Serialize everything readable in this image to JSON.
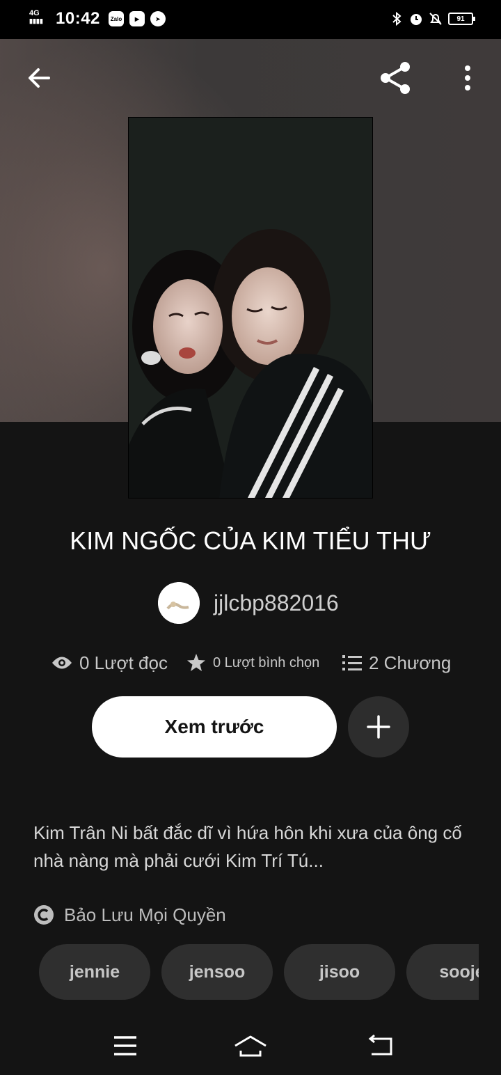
{
  "status_bar": {
    "network": "4G",
    "time": "10:42",
    "app_icons": [
      "Zalo",
      "youtube-icon",
      "compass-icon"
    ],
    "battery": "91"
  },
  "header": {
    "back_icon": "arrow-left-icon",
    "share_icon": "share-icon",
    "more_icon": "more-vertical-icon"
  },
  "story": {
    "title": "KIM NGỐC CỦA KIM TIỂU THƯ",
    "author": "jjlcbp882016",
    "stats": {
      "reads": "0 Lượt đọc",
      "votes": "0 Lượt bình chọn",
      "chapters": "2 Chương"
    },
    "preview_label": "Xem trước",
    "description": "Kim Trân Ni bất đắc dĩ vì hứa hôn khi xưa của ông cố nhà nàng mà phải cưới Kim Trí Tú...",
    "rights": "Bảo Lưu Mọi Quyền",
    "tags": [
      "jennie",
      "jensoo",
      "jisoo",
      "sooje"
    ]
  },
  "colors": {
    "background": "#141414",
    "button_bg": "#ffffff",
    "tag_bg": "#2f2f2f"
  }
}
